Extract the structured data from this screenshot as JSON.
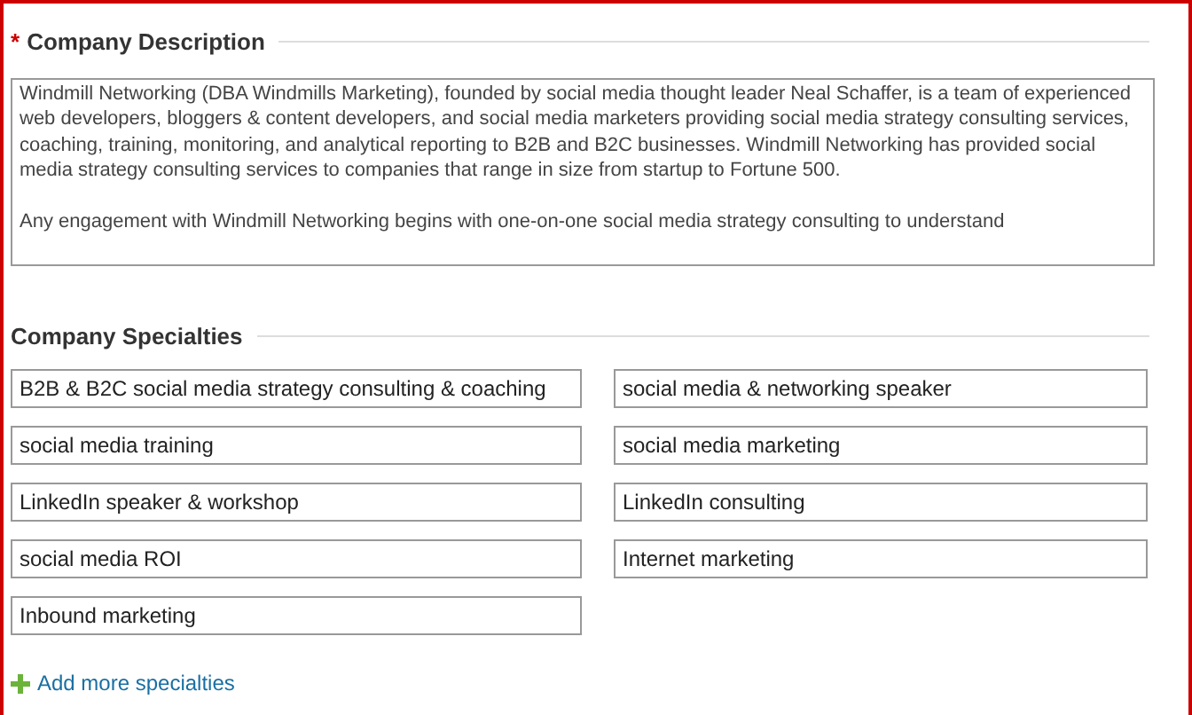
{
  "description": {
    "label": "Company Description",
    "required_mark": "*",
    "value": "Windmill Networking (DBA Windmills Marketing), founded by social media thought leader Neal Schaffer, is a team of experienced web developers, bloggers & content developers, and social media marketers providing social media strategy consulting services, coaching, training, monitoring, and analytical reporting to B2B and B2C businesses. Windmill Networking has provided social media strategy consulting services to companies that range in size from startup to Fortune 500.\n\nAny engagement with Windmill Networking begins with one-on-one social media strategy consulting to understand"
  },
  "specialties": {
    "label": "Company Specialties",
    "items": [
      {
        "value": "B2B & B2C social media strategy consulting & coaching"
      },
      {
        "value": "social media & networking speaker"
      },
      {
        "value": "social media training"
      },
      {
        "value": "social media marketing"
      },
      {
        "value": "LinkedIn speaker & workshop"
      },
      {
        "value": "LinkedIn consulting"
      },
      {
        "value": "social media ROI"
      },
      {
        "value": "Internet marketing"
      },
      {
        "value": "Inbound marketing"
      }
    ],
    "add_link": "Add more specialties"
  }
}
